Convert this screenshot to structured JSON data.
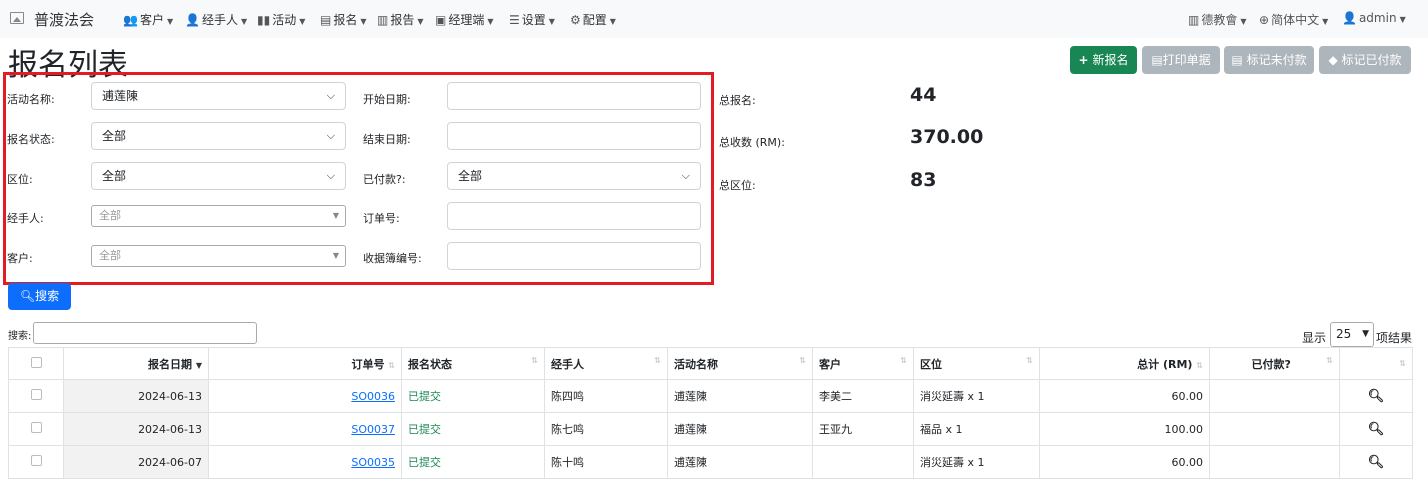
{
  "nav": {
    "brand": "普渡法会",
    "menus": [
      {
        "icon": "users-icon",
        "glyph": "👥",
        "label": "客户"
      },
      {
        "icon": "user-icon",
        "glyph": "👤",
        "label": "经手人"
      },
      {
        "icon": "chart-icon",
        "glyph": "▮▮",
        "label": "活动"
      },
      {
        "icon": "file-icon",
        "glyph": "▤",
        "label": "报名"
      },
      {
        "icon": "report-icon",
        "glyph": "▥",
        "label": "报告"
      },
      {
        "icon": "briefcase-icon",
        "glyph": "▣",
        "label": "经理端"
      },
      {
        "icon": "list-icon",
        "glyph": "☰",
        "label": "设置"
      },
      {
        "icon": "gear-icon",
        "glyph": "⚙",
        "label": "配置"
      }
    ],
    "right": [
      {
        "icon": "temple-icon",
        "glyph": "▥",
        "label": "德教會"
      },
      {
        "icon": "globe-icon",
        "glyph": "⊕",
        "label": "简体中文"
      },
      {
        "icon": "user-icon",
        "glyph": "👤",
        "label": "admin"
      }
    ]
  },
  "page": {
    "title": "报名列表"
  },
  "actions": {
    "new": "新报名",
    "print": "打印单据",
    "mark_unpaid": "标记未付款",
    "mark_paid": "标记已付款"
  },
  "filters": {
    "activity_label": "活动名称:",
    "activity_value": "逋莲陳",
    "status_label": "报名状态:",
    "status_value": "全部",
    "zone_label": "区位:",
    "zone_value": "全部",
    "handler_label": "经手人:",
    "handler_placeholder": "全部",
    "customer_label": "客户:",
    "customer_placeholder": "全部",
    "start_label": "开始日期:",
    "end_label": "结束日期:",
    "paid_label": "已付款?:",
    "paid_value": "全部",
    "order_label": "订单号:",
    "receipt_label": "收据簿编号:"
  },
  "stats": {
    "total_reg_label": "总报名:",
    "total_reg_value": "44",
    "total_income_label": "总收数 (RM):",
    "total_income_value": "370.00",
    "total_zone_label": "总区位:",
    "total_zone_value": "83"
  },
  "search": {
    "button": "搜索",
    "label": "搜索:"
  },
  "pagesize": {
    "prefix": "显示",
    "value": "25",
    "suffix": "项结果"
  },
  "table": {
    "headers": [
      "报名日期",
      "订单号",
      "报名状态",
      "经手人",
      "活动名称",
      "客户",
      "区位",
      "总计 (RM)",
      "已付款?"
    ],
    "rows": [
      {
        "date": "2024-06-13",
        "order": "SO0036",
        "status": "已提交",
        "handler": "陈四鸣",
        "activity": "逋莲陳",
        "customer": "李美二",
        "zone": "消災延壽 x 1",
        "total": "60.00",
        "paid": ""
      },
      {
        "date": "2024-06-13",
        "order": "SO0037",
        "status": "已提交",
        "handler": "陈七鸣",
        "activity": "逋莲陳",
        "customer": "王亚九",
        "zone": "福品 x 1",
        "total": "100.00",
        "paid": ""
      },
      {
        "date": "2024-06-07",
        "order": "SO0035",
        "status": "已提交",
        "handler": "陈十鸣",
        "activity": "逋莲陳",
        "customer": "",
        "zone": "消災延壽 x 1",
        "total": "60.00",
        "paid": ""
      }
    ]
  }
}
